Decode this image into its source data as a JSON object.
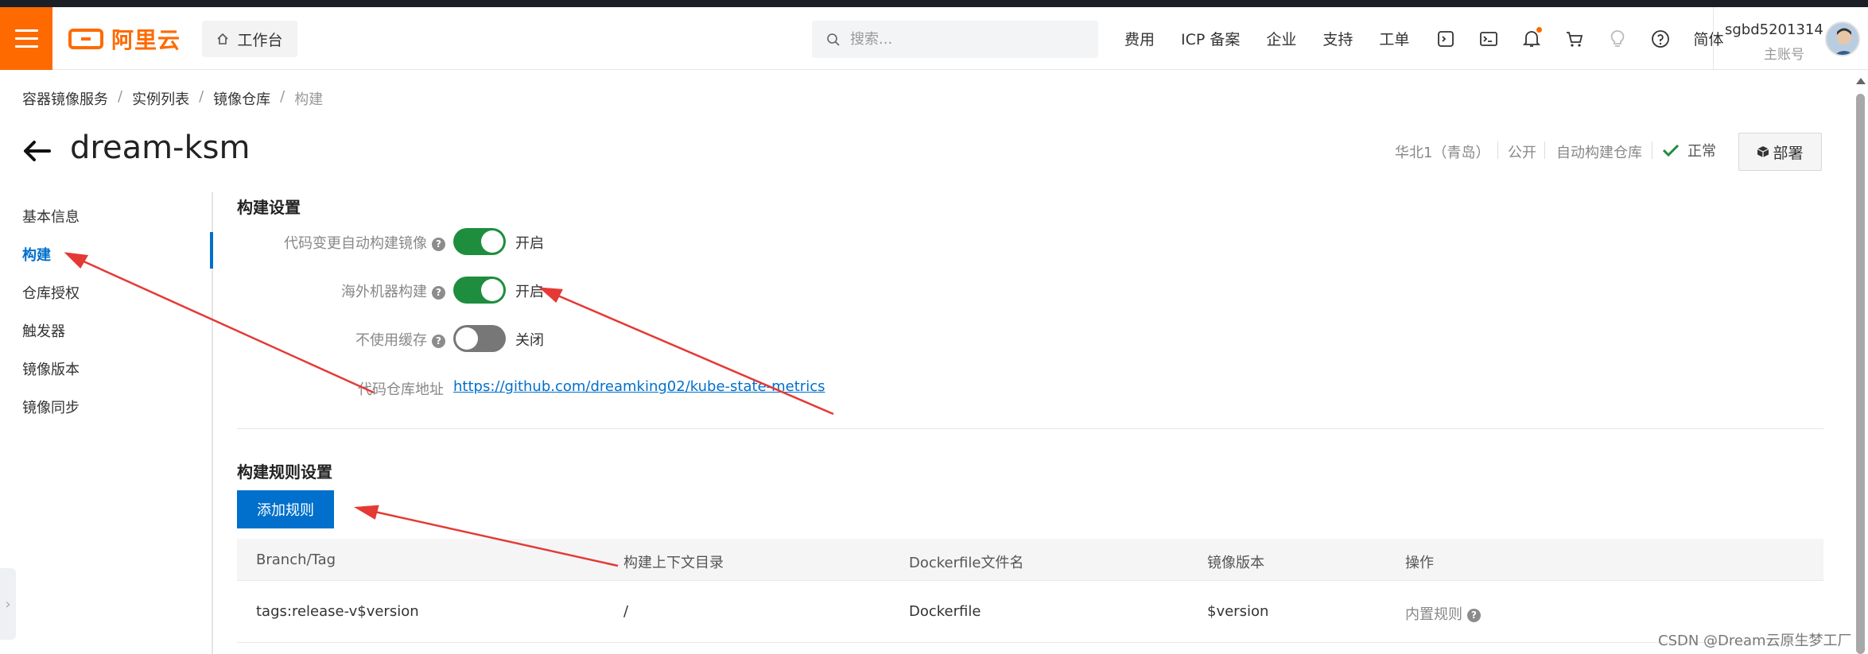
{
  "header": {
    "logo_text": "阿里云",
    "workbench_label": "工作台",
    "search_placeholder": "搜索...",
    "nav": [
      "费用",
      "ICP 备案",
      "企业",
      "支持",
      "工单"
    ],
    "lang": "简体",
    "user": {
      "name": "sgbd5201314",
      "role": "主账号"
    },
    "brand_color": "#ff6a00"
  },
  "breadcrumb": [
    "容器镜像服务",
    "实例列表",
    "镜像仓库",
    "构建"
  ],
  "page": {
    "title": "dream-ksm",
    "region": "华北1（青岛）",
    "visibility": "公开",
    "repo_type": "自动构建仓库",
    "status": "正常",
    "deploy_label": "部署"
  },
  "sidebar": {
    "items": [
      "基本信息",
      "构建",
      "仓库授权",
      "触发器",
      "镜像版本",
      "镜像同步"
    ],
    "active_index": 1
  },
  "build_settings": {
    "title": "构建设置",
    "auto_build": {
      "label": "代码变更自动构建镜像",
      "state": "开启",
      "on": true
    },
    "overseas_build": {
      "label": "海外机器构建",
      "state": "开启",
      "on": true
    },
    "no_cache": {
      "label": "不使用缓存",
      "state": "关闭",
      "on": false
    },
    "repo_url_label": "代码仓库地址",
    "repo_url": "https://github.com/dreamking02/kube-state-metrics"
  },
  "build_rules": {
    "title": "构建规则设置",
    "add_button": "添加规则",
    "columns": [
      "Branch/Tag",
      "构建上下文目录",
      "Dockerfile文件名",
      "镜像版本",
      "操作"
    ],
    "rows": [
      {
        "branch_tag": "tags:release-v$version",
        "context_dir": "/",
        "dockerfile": "Dockerfile",
        "version": "$version",
        "action": "内置规则"
      }
    ]
  },
  "watermark": "CSDN @Dream云原生梦工厂"
}
